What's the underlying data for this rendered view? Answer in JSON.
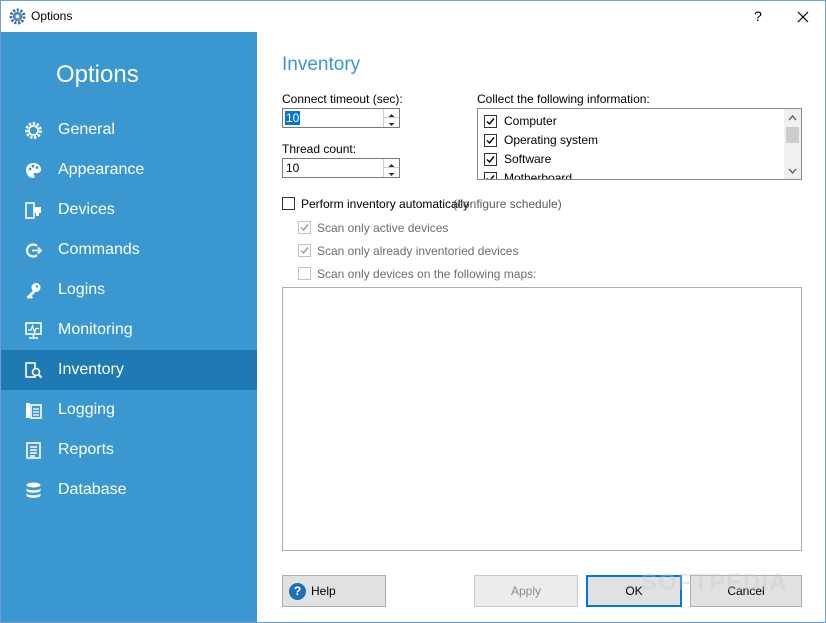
{
  "window": {
    "title": "Options",
    "help_glyph": "?",
    "close_glyph": "✕"
  },
  "sidebar": {
    "title": "Options",
    "items": [
      {
        "label": "General",
        "icon": "gear-icon"
      },
      {
        "label": "Appearance",
        "icon": "palette-icon"
      },
      {
        "label": "Devices",
        "icon": "devices-icon"
      },
      {
        "label": "Commands",
        "icon": "commands-icon"
      },
      {
        "label": "Logins",
        "icon": "key-icon"
      },
      {
        "label": "Monitoring",
        "icon": "monitor-icon"
      },
      {
        "label": "Inventory",
        "icon": "inventory-search-icon",
        "active": true
      },
      {
        "label": "Logging",
        "icon": "logging-icon"
      },
      {
        "label": "Reports",
        "icon": "reports-icon"
      },
      {
        "label": "Database",
        "icon": "database-icon"
      }
    ]
  },
  "main": {
    "heading": "Inventory",
    "connect_timeout": {
      "label": "Connect timeout (sec):",
      "value": "10"
    },
    "thread_count": {
      "label": "Thread count:",
      "value": "10"
    },
    "collect": {
      "label": "Collect the following information:",
      "items": [
        {
          "label": "Computer",
          "checked": true
        },
        {
          "label": "Operating system",
          "checked": true
        },
        {
          "label": "Software",
          "checked": true
        },
        {
          "label": "Motherboard",
          "checked": true
        }
      ]
    },
    "auto_inventory": {
      "label": "Perform inventory automatically",
      "link": "(configure schedule)",
      "checked": false
    },
    "scan_active": {
      "label": "Scan only active devices",
      "checked": true
    },
    "scan_inventoried": {
      "label": "Scan only already inventoried devices",
      "checked": true
    },
    "scan_maps": {
      "label": "Scan only devices on the following maps:",
      "checked": false
    }
  },
  "buttons": {
    "help": "Help",
    "apply": "Apply",
    "ok": "OK",
    "cancel": "Cancel"
  },
  "watermark": "SOFTPEDIA",
  "colors": {
    "sidebar": "#3a97cf",
    "sidebar_active": "#1f7ab3",
    "heading": "#3a97cf",
    "accent": "#0078d7"
  }
}
